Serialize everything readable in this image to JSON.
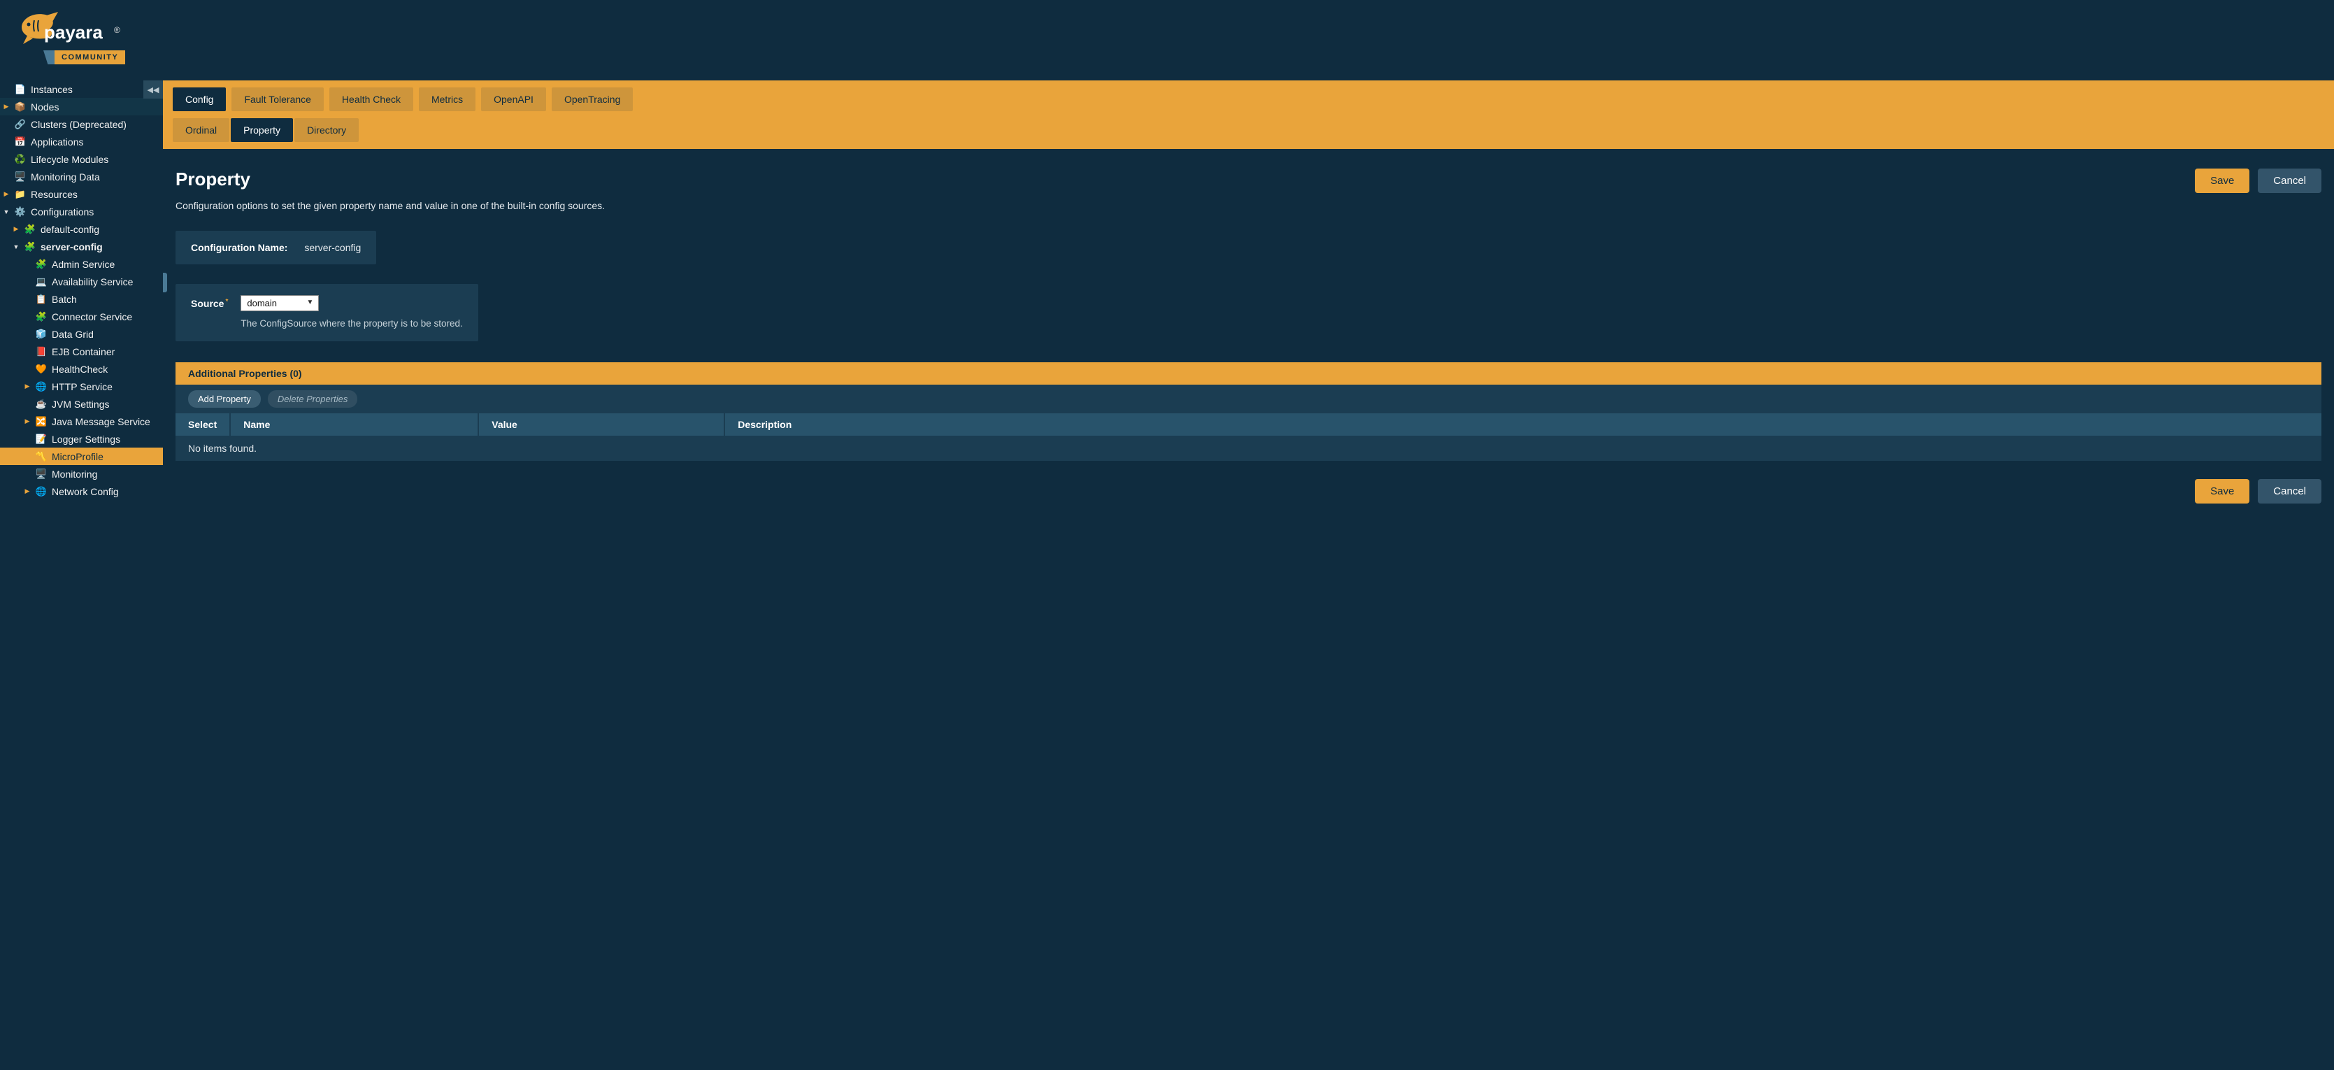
{
  "brand": {
    "name": "payara",
    "edition": "COMMUNITY"
  },
  "sidebar": {
    "items": [
      {
        "label": "Instances",
        "depth": 0,
        "arrow": "blank",
        "icon": "📄",
        "selected": false,
        "hover": false
      },
      {
        "label": "Nodes",
        "depth": 0,
        "arrow": "right",
        "icon": "📦",
        "selected": false,
        "hover": true
      },
      {
        "label": "Clusters (Deprecated)",
        "depth": 0,
        "arrow": "blank",
        "icon": "🔗",
        "selected": false
      },
      {
        "label": "Applications",
        "depth": 0,
        "arrow": "blank",
        "icon": "📅",
        "selected": false
      },
      {
        "label": "Lifecycle Modules",
        "depth": 0,
        "arrow": "blank",
        "icon": "♻️",
        "selected": false
      },
      {
        "label": "Monitoring Data",
        "depth": 0,
        "arrow": "blank",
        "icon": "🖥️",
        "selected": false
      },
      {
        "label": "Resources",
        "depth": 0,
        "arrow": "right",
        "icon": "📁",
        "selected": false
      },
      {
        "label": "Configurations",
        "depth": 0,
        "arrow": "down",
        "icon": "⚙️",
        "selected": false
      },
      {
        "label": "default-config",
        "depth": 1,
        "arrow": "right",
        "icon": "🧩",
        "selected": false
      },
      {
        "label": "server-config",
        "depth": 1,
        "arrow": "down",
        "icon": "🧩",
        "selected": false,
        "bold": true
      },
      {
        "label": "Admin Service",
        "depth": 2,
        "arrow": "blank",
        "icon": "🧩",
        "selected": false
      },
      {
        "label": "Availability Service",
        "depth": 2,
        "arrow": "blank",
        "icon": "💻",
        "selected": false
      },
      {
        "label": "Batch",
        "depth": 2,
        "arrow": "blank",
        "icon": "📋",
        "selected": false
      },
      {
        "label": "Connector Service",
        "depth": 2,
        "arrow": "blank",
        "icon": "🧩",
        "selected": false
      },
      {
        "label": "Data Grid",
        "depth": 2,
        "arrow": "blank",
        "icon": "🧊",
        "selected": false
      },
      {
        "label": "EJB Container",
        "depth": 2,
        "arrow": "blank",
        "icon": "📕",
        "selected": false
      },
      {
        "label": "HealthCheck",
        "depth": 2,
        "arrow": "blank",
        "icon": "🧡",
        "selected": false
      },
      {
        "label": "HTTP Service",
        "depth": 2,
        "arrow": "right",
        "icon": "🌐",
        "selected": false
      },
      {
        "label": "JVM Settings",
        "depth": 2,
        "arrow": "blank",
        "icon": "☕",
        "selected": false
      },
      {
        "label": "Java Message Service",
        "depth": 2,
        "arrow": "right",
        "icon": "🔀",
        "selected": false
      },
      {
        "label": "Logger Settings",
        "depth": 2,
        "arrow": "blank",
        "icon": "📝",
        "selected": false
      },
      {
        "label": "MicroProfile",
        "depth": 2,
        "arrow": "blank",
        "icon": "〽️",
        "selected": true
      },
      {
        "label": "Monitoring",
        "depth": 2,
        "arrow": "blank",
        "icon": "🖥️",
        "selected": false
      },
      {
        "label": "Network Config",
        "depth": 2,
        "arrow": "right",
        "icon": "🌐",
        "selected": false
      }
    ]
  },
  "tabs": {
    "primary": [
      {
        "label": "Config",
        "active": true
      },
      {
        "label": "Fault Tolerance"
      },
      {
        "label": "Health Check"
      },
      {
        "label": "Metrics"
      },
      {
        "label": "OpenAPI"
      },
      {
        "label": "OpenTracing"
      }
    ],
    "secondary": [
      {
        "label": "Ordinal"
      },
      {
        "label": "Property",
        "active": true
      },
      {
        "label": "Directory"
      }
    ]
  },
  "page": {
    "title": "Property",
    "description": "Configuration options to set the given property name and value in one of the built-in config sources.",
    "save": "Save",
    "cancel": "Cancel"
  },
  "config": {
    "name_label": "Configuration Name:",
    "name_value": "server-config",
    "source_label": "Source",
    "source_value": "domain",
    "source_hint": "The ConfigSource where the property is to be stored."
  },
  "table": {
    "heading": "Additional Properties (0)",
    "add": "Add Property",
    "delete": "Delete Properties",
    "cols": {
      "select": "Select",
      "name": "Name",
      "value": "Value",
      "description": "Description"
    },
    "empty": "No items found."
  }
}
